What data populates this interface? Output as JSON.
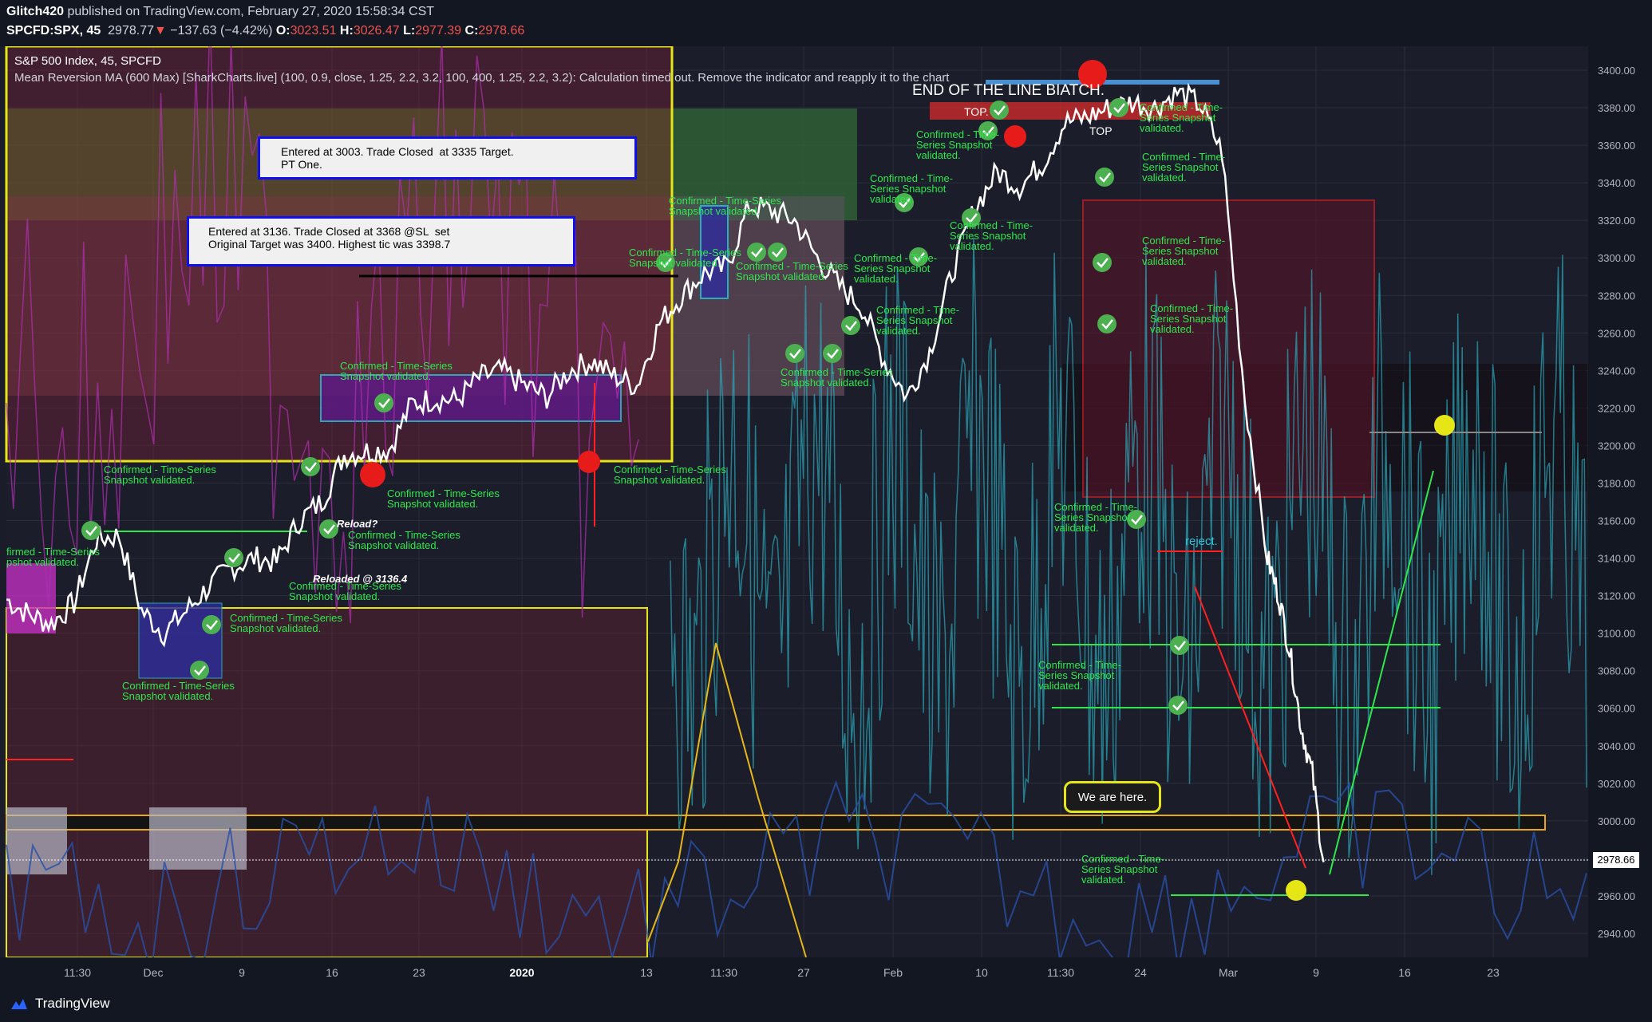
{
  "header": {
    "publisher": "Glitch420",
    "published_text": " published on TradingView.com, February 27, 2020 15:58:34 CST",
    "symbol": "SPCFD:SPX, 45",
    "last": "2978.77",
    "arrow": "▼",
    "change": "−137.63 (−4.42%)",
    "o_label": "O:",
    "o": "3023.51",
    "h_label": "H:",
    "h": "3026.47",
    "l_label": "L:",
    "l": "2977.39",
    "c_label": "C:",
    "c": "2978.66"
  },
  "legend": {
    "line1": "S&P 500 Index, 45, SPCFD",
    "line2": "Mean Reversion MA (600 Max) [SharkCharts.live] (100, 0.9, close, 1.25, 2.2, 3.2, 100, 400, 1.25, 2.2, 3.2): Calculation timed out. Remove the indicator and reapply it to the chart"
  },
  "annotations": {
    "trade1": "Entered at 3003. Trade Closed  at 3335 Target.\nPT One.",
    "trade2": "Entered at 3136. Trade Closed at 3368 @SL  set\nOriginal Target was 3400. Highest tic was 3398.7",
    "end_line": "END OF THE LINE BIATCH.",
    "we_are_here": "We are here.",
    "reload_q": "Reload?",
    "reloaded": "Reloaded @ 3136.4",
    "reject": "reject.",
    "top1": "TOP.",
    "top2": "TOP",
    "conf_full": "Confirmed - Time-Series\nSnapshot validated.",
    "conf_short": "Confirmed - Time-\nSeries Snapshot\nvalidated.",
    "conf_cut": "firmed - Time-Series\npshot validated.",
    "conf_cut2": "Confirmed - Time-\nSeries Snapsh\nvalidated.",
    "conf_cut3": "Confirmed - Time-\nSeries Snapshot\nvalidated."
  },
  "footer": {
    "brand": "TradingView"
  },
  "colors": {
    "price": "#ffffff",
    "accent_green": "#2ee84b",
    "down": "#ef5350",
    "yellow": "#e6e617",
    "cyan": "#26c6da",
    "magenta": "#c02fc0"
  },
  "chart_data": {
    "type": "line",
    "title": "S&P 500 Index, 45, SPCFD",
    "xlabel": "",
    "ylabel": "",
    "ylim": [
      2925,
      3420
    ],
    "y_ticks": [
      "3400.00",
      "3380.00",
      "3360.00",
      "3340.00",
      "3320.00",
      "3300.00",
      "3280.00",
      "3260.00",
      "3240.00",
      "3220.00",
      "3200.00",
      "3180.00",
      "3160.00",
      "3140.00",
      "3120.00",
      "3100.00",
      "3080.00",
      "3060.00",
      "3040.00",
      "3020.00",
      "3000.00",
      "2980.00",
      "2960.00",
      "2940.00"
    ],
    "x_ticks": [
      "11:30",
      "Dec",
      "9",
      "16",
      "23",
      "2020",
      "13",
      "11:30",
      "27",
      "Feb",
      "10",
      "11:30",
      "24",
      "Mar",
      "9",
      "16",
      "23"
    ],
    "last_price_label": "2978.66",
    "series": [
      {
        "name": "",
        "x_days": [
          0,
          2,
          4,
          6,
          8,
          10,
          12,
          14,
          16,
          18,
          20,
          22,
          24,
          26,
          28,
          30,
          32,
          34,
          36,
          38,
          40,
          42,
          44,
          46,
          48,
          50,
          52,
          54,
          56,
          58,
          60,
          62,
          64,
          66,
          68,
          70,
          72,
          74,
          76,
          78,
          80,
          82,
          84,
          86,
          88,
          90,
          92,
          94,
          96,
          98,
          100,
          102,
          104,
          106,
          108,
          110,
          112,
          113,
          114,
          115,
          116,
          117
        ],
        "values": [
          3118,
          3110,
          3105,
          3116,
          3150,
          3152,
          3112,
          3100,
          3112,
          3125,
          3135,
          3140,
          3138,
          3160,
          3170,
          3195,
          3197,
          3198,
          3222,
          3225,
          3224,
          3236,
          3240,
          3232,
          3226,
          3240,
          3245,
          3237,
          3232,
          3265,
          3280,
          3292,
          3295,
          3328,
          3325,
          3320,
          3300,
          3285,
          3274,
          3245,
          3226,
          3250,
          3292,
          3326,
          3346,
          3338,
          3350,
          3372,
          3375,
          3380,
          3383,
          3380,
          3388,
          3382,
          3356,
          3225,
          3140,
          3120,
          3090,
          3050,
          3025,
          2978
        ]
      }
    ]
  }
}
